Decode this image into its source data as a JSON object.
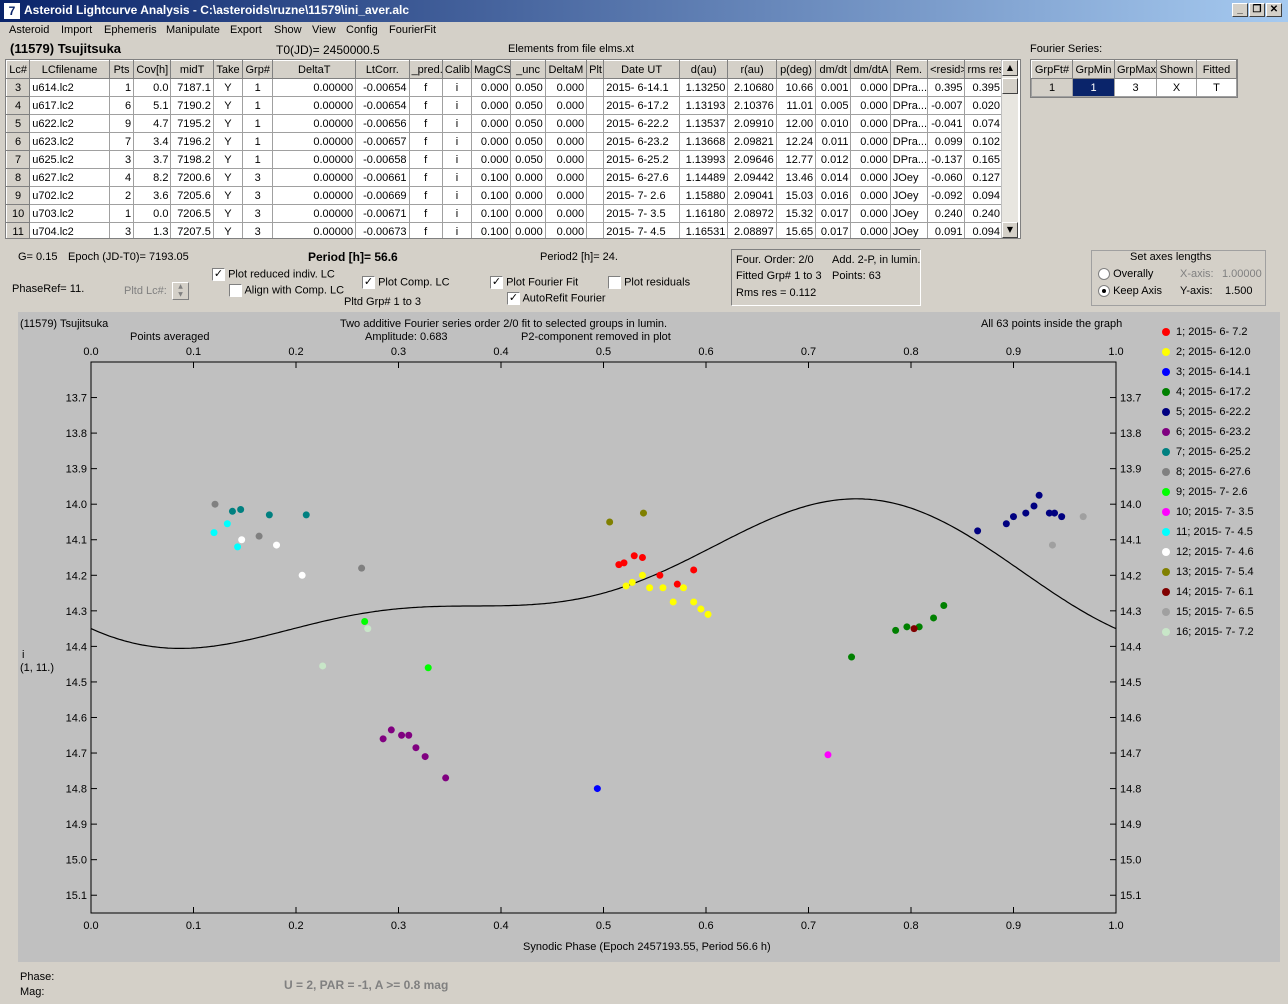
{
  "window": {
    "title": "Asteroid Lightcurve Analysis - C:\\asteroids\\ruzne\\11579\\ini_aver.alc",
    "icon": "7"
  },
  "menu": [
    "Asteroid",
    "Import",
    "Ephemeris",
    "Manipulate",
    "Export",
    "Show",
    "View",
    "Config",
    "FourierFit"
  ],
  "header": {
    "asteroid": "(11579) Tsujitsuka",
    "t0": "T0(JD)= 2450000.5",
    "elements": "Elements from file elms.xt"
  },
  "lc_table": {
    "columns": [
      "Lc#",
      "LCfilename",
      "Pts",
      "Cov[h]",
      "midT",
      "Take",
      "Grp#",
      "DeltaT",
      "LtCorr.",
      "_pred.",
      "Calib.",
      "MagCS",
      "_unc",
      "DeltaM",
      "Plt",
      "Date UT",
      "d(au)",
      "r(au)",
      "p(deg)",
      "dm/dt",
      "dm/dtA",
      "Rem.",
      "<resid>",
      "rms res"
    ],
    "rows": [
      [
        "3",
        "u614.lc2",
        "1",
        "0.0",
        "7187.1",
        "Y",
        "1",
        "0.00000",
        "-0.00654",
        "f",
        "i",
        "0.000",
        "0.050",
        "0.000",
        "",
        "2015- 6-14.1",
        "1.13250",
        "2.10680",
        "10.66",
        "0.001",
        "0.000",
        "DPra...",
        "0.395",
        "0.395"
      ],
      [
        "4",
        "u617.lc2",
        "6",
        "5.1",
        "7190.2",
        "Y",
        "1",
        "0.00000",
        "-0.00654",
        "f",
        "i",
        "0.000",
        "0.050",
        "0.000",
        "",
        "2015- 6-17.2",
        "1.13193",
        "2.10376",
        "11.01",
        "0.005",
        "0.000",
        "DPra...",
        "-0.007",
        "0.020"
      ],
      [
        "5",
        "u622.lc2",
        "9",
        "4.7",
        "7195.2",
        "Y",
        "1",
        "0.00000",
        "-0.00656",
        "f",
        "i",
        "0.000",
        "0.050",
        "0.000",
        "",
        "2015- 6-22.2",
        "1.13537",
        "2.09910",
        "12.00",
        "0.010",
        "0.000",
        "DPra...",
        "-0.041",
        "0.074"
      ],
      [
        "6",
        "u623.lc2",
        "7",
        "3.4",
        "7196.2",
        "Y",
        "1",
        "0.00000",
        "-0.00657",
        "f",
        "i",
        "0.000",
        "0.050",
        "0.000",
        "",
        "2015- 6-23.2",
        "1.13668",
        "2.09821",
        "12.24",
        "0.011",
        "0.000",
        "DPra...",
        "0.099",
        "0.102"
      ],
      [
        "7",
        "u625.lc2",
        "3",
        "3.7",
        "7198.2",
        "Y",
        "1",
        "0.00000",
        "-0.00658",
        "f",
        "i",
        "0.000",
        "0.050",
        "0.000",
        "",
        "2015- 6-25.2",
        "1.13993",
        "2.09646",
        "12.77",
        "0.012",
        "0.000",
        "DPra...",
        "-0.137",
        "0.165"
      ],
      [
        "8",
        "u627.lc2",
        "4",
        "8.2",
        "7200.6",
        "Y",
        "3",
        "0.00000",
        "-0.00661",
        "f",
        "i",
        "0.100",
        "0.000",
        "0.000",
        "",
        "2015- 6-27.6",
        "1.14489",
        "2.09442",
        "13.46",
        "0.014",
        "0.000",
        "JOey",
        "-0.060",
        "0.127"
      ],
      [
        "9",
        "u702.lc2",
        "2",
        "3.6",
        "7205.6",
        "Y",
        "3",
        "0.00000",
        "-0.00669",
        "f",
        "i",
        "0.100",
        "0.000",
        "0.000",
        "",
        "2015- 7- 2.6",
        "1.15880",
        "2.09041",
        "15.03",
        "0.016",
        "0.000",
        "JOey",
        "-0.092",
        "0.094"
      ],
      [
        "10",
        "u703.lc2",
        "1",
        "0.0",
        "7206.5",
        "Y",
        "3",
        "0.00000",
        "-0.00671",
        "f",
        "i",
        "0.100",
        "0.000",
        "0.000",
        "",
        "2015- 7- 3.5",
        "1.16180",
        "2.08972",
        "15.32",
        "0.017",
        "0.000",
        "JOey",
        "0.240",
        "0.240"
      ],
      [
        "11",
        "u704.lc2",
        "3",
        "1.3",
        "7207.5",
        "Y",
        "3",
        "0.00000",
        "-0.00673",
        "f",
        "i",
        "0.100",
        "0.000",
        "0.000",
        "",
        "2015- 7- 4.5",
        "1.16531",
        "2.08897",
        "15.65",
        "0.017",
        "0.000",
        "JOey",
        "0.091",
        "0.094"
      ]
    ]
  },
  "fourier_series": {
    "label": "Fourier Series:",
    "columns": [
      "GrpFt#",
      "GrpMin",
      "GrpMax",
      "Shown",
      "Fitted"
    ],
    "row": [
      "1",
      "1",
      "3",
      "X",
      "T"
    ]
  },
  "params": {
    "g": "G= 0.15",
    "epoch": "Epoch (JD-T0)= 7193.05",
    "period": "Period [h]= 56.6",
    "period2": "Period2 [h]= 24.",
    "phase_ref": "PhaseRef= 11.",
    "pltd_lc": "Pltd Lc#:",
    "pltd_grp": "Pltd Grp#  1   to   3"
  },
  "checkboxes": {
    "plot_reduced": {
      "label": "Plot reduced indiv. LC",
      "checked": true
    },
    "align": {
      "label": "Align with Comp. LC",
      "checked": false
    },
    "plot_comp": {
      "label": "Plot Comp. LC",
      "checked": true
    },
    "plot_fourier": {
      "label": "Plot Fourier Fit",
      "checked": true
    },
    "plot_residuals": {
      "label": "Plot residuals",
      "checked": false
    },
    "autorefit": {
      "label": "AutoRefit Fourier",
      "checked": true
    }
  },
  "fit_info": {
    "order": "Four. Order:  2/0",
    "add": "Add. 2-P, in lumin.",
    "fitted": "Fitted Grp# 1 to 3",
    "points": "Points: 63",
    "rms": "Rms res     = 0.112"
  },
  "axes_lengths": {
    "title": "Set axes lengths",
    "overally": "Overally",
    "keep_axis": "Keep Axis",
    "x_label": "X-axis:",
    "x_value": "1.00000",
    "y_label": "Y-axis:",
    "y_value": "1.500",
    "selected": "Keep Axis"
  },
  "plot_text": {
    "name": "(11579) Tsujitsuka",
    "averaged": "Points averaged",
    "line1": "Two additive Fourier series order 2/0 fit to selected groups in lumin.",
    "amplitude": "Amplitude: 0.683",
    "p2": "P2-component removed in plot",
    "inside": "All 63 points inside the graph",
    "ylabel": "i",
    "ylabel2": "(1, 11.)"
  },
  "status": {
    "phase": "Phase:",
    "mag": "Mag:",
    "bottom": "U = 2, PAR = -1, A >= 0.8 mag"
  },
  "chart_data": {
    "type": "scatter",
    "xlabel": "Synodic Phase (Epoch 2457193.55, Period 56.6 h)",
    "ylabel": "i",
    "xlim": [
      0.0,
      1.0
    ],
    "ylim": [
      15.15,
      13.6
    ],
    "y_inverted": true,
    "xticks": [
      "0.0",
      "0.1",
      "0.2",
      "0.3",
      "0.4",
      "0.5",
      "0.6",
      "0.7",
      "0.8",
      "0.9",
      "1.0"
    ],
    "yticks": [
      "13.7",
      "13.8",
      "13.9",
      "14.0",
      "14.1",
      "14.2",
      "14.3",
      "14.4",
      "14.5",
      "14.6",
      "14.7",
      "14.8",
      "14.9",
      "15.0",
      "15.1"
    ],
    "legend_position": "right",
    "series": [
      {
        "name": "1; 2015- 6- 7.2",
        "color": "#ff0000",
        "points": [
          [
            0.515,
            14.17
          ],
          [
            0.52,
            14.165
          ],
          [
            0.53,
            14.145
          ],
          [
            0.538,
            14.15
          ],
          [
            0.555,
            14.2
          ],
          [
            0.572,
            14.225
          ],
          [
            0.588,
            14.185
          ]
        ]
      },
      {
        "name": "2; 2015- 6-12.0",
        "color": "#ffff00",
        "points": [
          [
            0.522,
            14.23
          ],
          [
            0.528,
            14.22
          ],
          [
            0.538,
            14.2
          ],
          [
            0.545,
            14.235
          ],
          [
            0.558,
            14.235
          ],
          [
            0.568,
            14.275
          ],
          [
            0.578,
            14.235
          ],
          [
            0.588,
            14.275
          ],
          [
            0.595,
            14.295
          ],
          [
            0.602,
            14.31
          ]
        ]
      },
      {
        "name": "3; 2015- 6-14.1",
        "color": "#0000ff",
        "points": [
          [
            0.494,
            14.8
          ]
        ]
      },
      {
        "name": "4; 2015- 6-17.2",
        "color": "#008000",
        "points": [
          [
            0.742,
            14.43
          ],
          [
            0.785,
            14.355
          ],
          [
            0.796,
            14.345
          ],
          [
            0.808,
            14.345
          ],
          [
            0.822,
            14.32
          ],
          [
            0.832,
            14.285
          ]
        ]
      },
      {
        "name": "5; 2015- 6-22.2",
        "color": "#000080",
        "points": [
          [
            0.865,
            14.075
          ],
          [
            0.893,
            14.055
          ],
          [
            0.9,
            14.035
          ],
          [
            0.912,
            14.025
          ],
          [
            0.92,
            14.005
          ],
          [
            0.925,
            13.975
          ],
          [
            0.935,
            14.025
          ],
          [
            0.94,
            14.025
          ],
          [
            0.947,
            14.035
          ]
        ]
      },
      {
        "name": "6; 2015- 6-23.2",
        "color": "#800080",
        "points": [
          [
            0.285,
            14.66
          ],
          [
            0.293,
            14.635
          ],
          [
            0.303,
            14.65
          ],
          [
            0.31,
            14.65
          ],
          [
            0.317,
            14.685
          ],
          [
            0.326,
            14.71
          ],
          [
            0.346,
            14.77
          ]
        ]
      },
      {
        "name": "7; 2015- 6-25.2",
        "color": "#008080",
        "points": [
          [
            0.138,
            14.02
          ],
          [
            0.146,
            14.015
          ],
          [
            0.174,
            14.03
          ],
          [
            0.21,
            14.03
          ]
        ]
      },
      {
        "name": "8; 2015- 6-27.6",
        "color": "#808080",
        "points": [
          [
            0.121,
            14.0
          ],
          [
            0.164,
            14.09
          ],
          [
            0.264,
            14.18
          ]
        ]
      },
      {
        "name": "9; 2015- 7- 2.6",
        "color": "#00ff00",
        "points": [
          [
            0.267,
            14.33
          ],
          [
            0.329,
            14.46
          ]
        ]
      },
      {
        "name": "10; 2015- 7- 3.5",
        "color": "#ff00ff",
        "points": [
          [
            0.719,
            14.705
          ]
        ]
      },
      {
        "name": "11; 2015- 7- 4.5",
        "color": "#00ffff",
        "points": [
          [
            0.12,
            14.08
          ],
          [
            0.133,
            14.055
          ],
          [
            0.143,
            14.12
          ]
        ]
      },
      {
        "name": "12; 2015- 7- 4.6",
        "color": "#ffffff",
        "points": [
          [
            0.147,
            14.1
          ],
          [
            0.181,
            14.115
          ],
          [
            0.206,
            14.2
          ]
        ]
      },
      {
        "name": "13; 2015- 7- 5.4",
        "color": "#808000",
        "points": [
          [
            0.506,
            14.05
          ],
          [
            0.539,
            14.025
          ]
        ]
      },
      {
        "name": "14; 2015- 7- 6.1",
        "color": "#800000",
        "points": [
          [
            0.803,
            14.35
          ]
        ]
      },
      {
        "name": "15; 2015- 7- 6.5",
        "color": "#a0a0a0",
        "points": [
          [
            0.938,
            14.115
          ],
          [
            0.968,
            14.035
          ]
        ]
      },
      {
        "name": "16; 2015- 7- 7.2",
        "color": "#c8e6c8",
        "points": [
          [
            0.226,
            14.455
          ],
          [
            0.27,
            14.35
          ]
        ]
      }
    ],
    "fourier_curve": {
      "mean": 14.225,
      "terms": [
        [
          0.05,
          0.165
        ],
        [
          0.075,
          0.02
        ]
      ],
      "color": "#000000"
    }
  }
}
